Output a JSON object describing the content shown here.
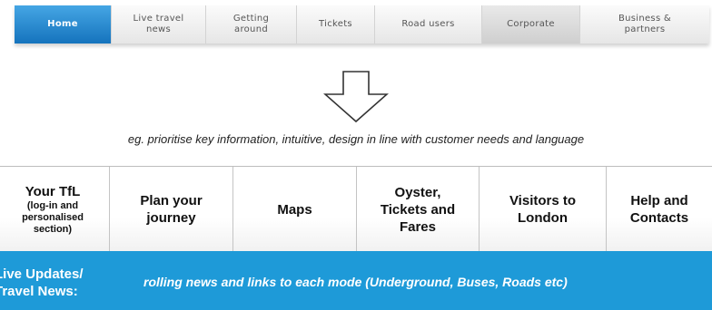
{
  "old_nav": {
    "tabs": [
      {
        "label": "Home"
      },
      {
        "label": "Live travel\nnews"
      },
      {
        "label": "Getting\naround"
      },
      {
        "label": "Tickets"
      },
      {
        "label": "Road users"
      },
      {
        "label": "Corporate"
      },
      {
        "label": "Business &\npartners"
      }
    ]
  },
  "arrow": {
    "icon": "down-arrow-outline-icon"
  },
  "caption": "eg. prioritise key information, intuitive, design in line with customer needs and language",
  "new_nav": {
    "items": [
      {
        "label": "Your TfL",
        "sub": "(log-in and\npersonalised\nsection)"
      },
      {
        "label": "Plan your\njourney",
        "sub": ""
      },
      {
        "label": "Maps",
        "sub": ""
      },
      {
        "label": "Oyster,\nTickets and\nFares",
        "sub": ""
      },
      {
        "label": "Visitors to\nLondon",
        "sub": ""
      },
      {
        "label": "Help and\nContacts",
        "sub": ""
      }
    ]
  },
  "band": {
    "label": "Live Updates/\nTravel News:",
    "text": "rolling news and links to each mode (Underground, Buses, Roads etc)",
    "color": "#1e9ad8"
  }
}
